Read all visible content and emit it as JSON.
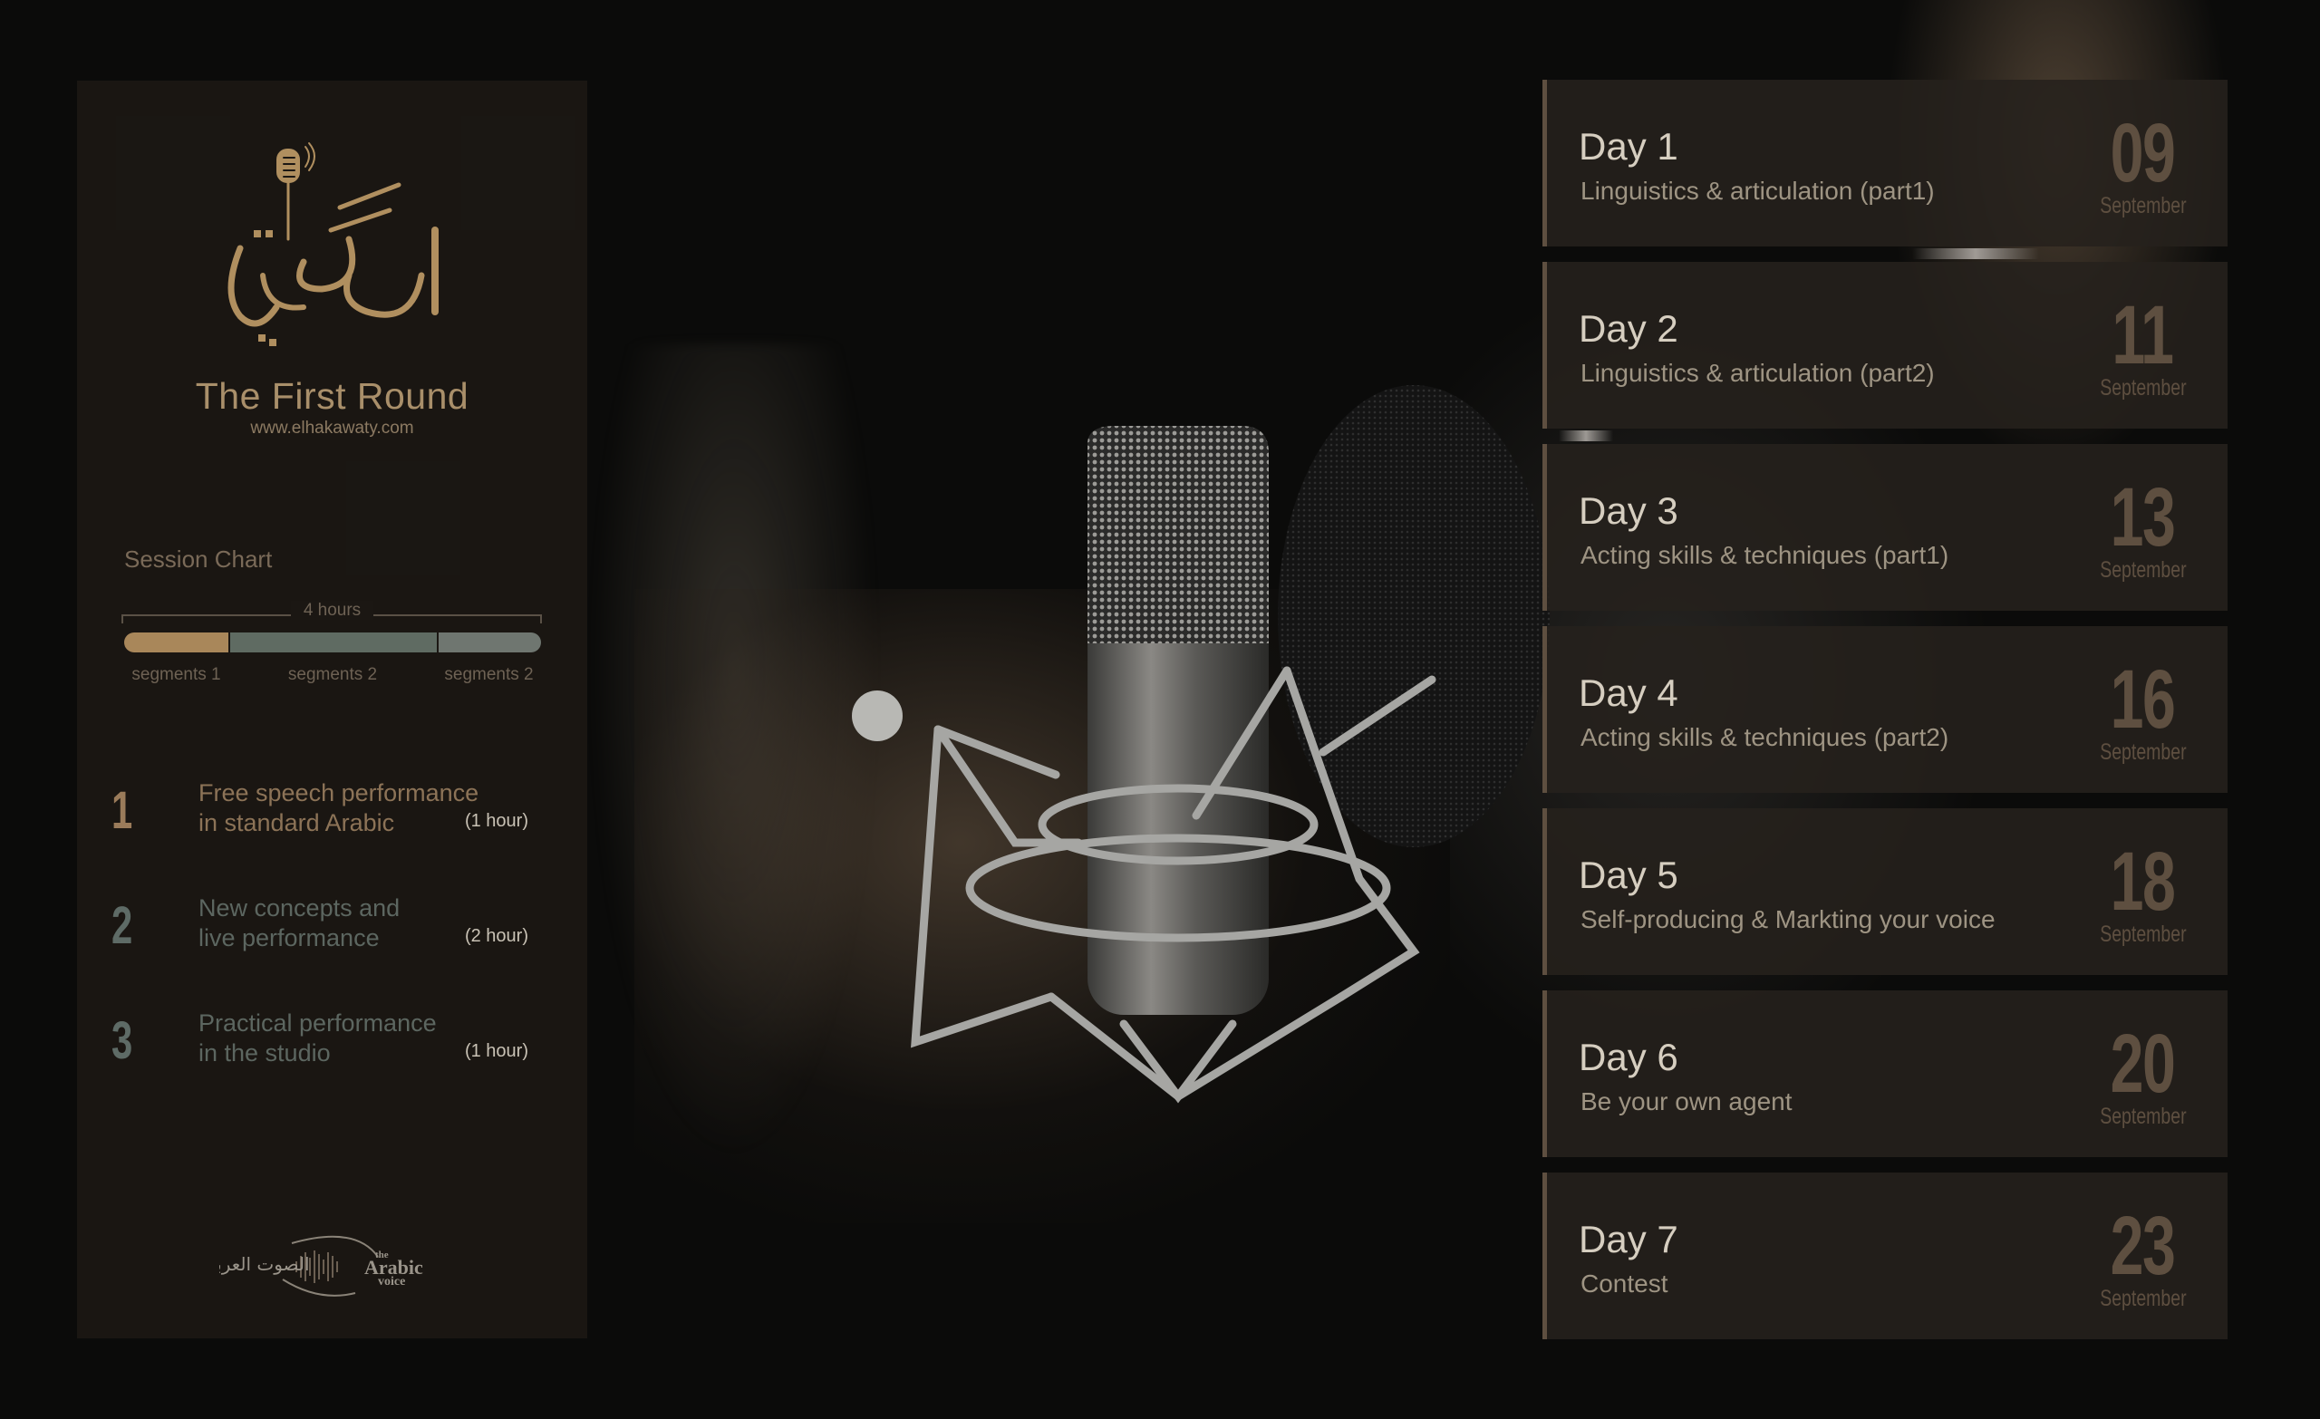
{
  "brand": {
    "logo_arabic": "الحكواتي",
    "title": "The First Round",
    "website": "www.elhakawaty.com",
    "colors": {
      "gold": "#a98f6a",
      "accent_brown": "#5e4f40",
      "grey_green": "#5e6b66",
      "panel_bg": "#1b1713",
      "page_bg": "#0b0b0a"
    }
  },
  "session_chart": {
    "title": "Session Chart",
    "total_label": "4 hours",
    "chart_data": {
      "type": "bar",
      "orientation": "stacked-horizontal",
      "title": "Session Chart",
      "total": 4,
      "unit": "hours",
      "categories": [
        "segments 1",
        "segments 2",
        "segments 2"
      ],
      "values": [
        1,
        2,
        1
      ],
      "colors": [
        "#a9875a",
        "#5f6b62",
        "#6f7670"
      ]
    }
  },
  "sessions": [
    {
      "number": "1",
      "line1": "Free speech performance",
      "line2": "in standard Arabic",
      "duration": "(1 hour)",
      "color": "#9a7b5a"
    },
    {
      "number": "2",
      "line1": "New concepts and",
      "line2": "live performance",
      "duration": "(2 hour)",
      "color": "#5e6b66"
    },
    {
      "number": "3",
      "line1": "Practical performance",
      "line2": "in the studio",
      "duration": "(1 hour)",
      "color": "#5e6b66"
    }
  ],
  "sponsor": {
    "arabic": "الصوت العربي",
    "line1": "the",
    "line2": "Arabic",
    "line3": "voice"
  },
  "schedule": [
    {
      "day": "Day 1",
      "topic": "Linguistics & articulation (part1)",
      "date": "09",
      "month": "September"
    },
    {
      "day": "Day 2",
      "topic": "Linguistics & articulation (part2)",
      "date": "11",
      "month": "September"
    },
    {
      "day": "Day 3",
      "topic": "Acting skills & techniques (part1)",
      "date": "13",
      "month": "September"
    },
    {
      "day": "Day 4",
      "topic": "Acting skills & techniques (part2)",
      "date": "16",
      "month": "September"
    },
    {
      "day": "Day 5",
      "topic": "Self-producing & Markting your voice",
      "date": "18",
      "month": "September"
    },
    {
      "day": "Day 6",
      "topic": "Be your own agent",
      "date": "20",
      "month": "September"
    },
    {
      "day": "Day 7",
      "topic": "Contest",
      "date": "23",
      "month": "September"
    }
  ]
}
